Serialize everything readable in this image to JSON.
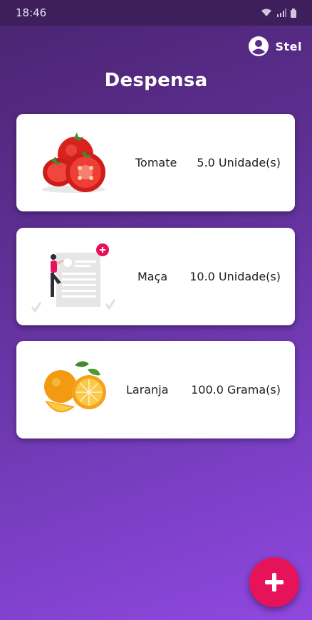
{
  "status_bar": {
    "time": "18:46"
  },
  "header": {
    "user_name": "Stel",
    "title": "Despensa"
  },
  "items": [
    {
      "name": "Tomate",
      "quantity": "5.0 Unidade(s)",
      "image": "tomato-image"
    },
    {
      "name": "Maça",
      "quantity": "10.0 Unidade(s)",
      "image": "placeholder-illustration"
    },
    {
      "name": "Laranja",
      "quantity": "100.0 Grama(s)",
      "image": "orange-image"
    }
  ],
  "colors": {
    "accent": "#e6125a",
    "background_top": "#4a2470",
    "background_bottom": "#9048e0"
  },
  "fab": {
    "icon": "plus-icon"
  }
}
